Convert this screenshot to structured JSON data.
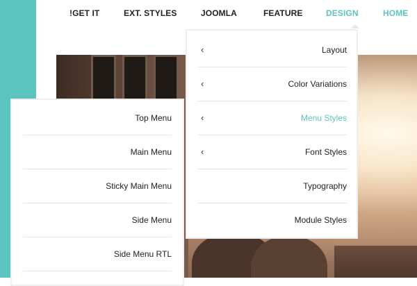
{
  "topnav": {
    "items": [
      {
        "label": "!GET IT",
        "active": false
      },
      {
        "label": "EXT. STYLES",
        "active": false
      },
      {
        "label": "JOOMLA",
        "active": false
      },
      {
        "label": "FEATURE",
        "active": false
      },
      {
        "label": "DESIGN",
        "active": true
      },
      {
        "label": "HOME",
        "active": true
      }
    ]
  },
  "design_menu": {
    "items": [
      {
        "label": "Layout",
        "has_submenu": true
      },
      {
        "label": "Color Variations",
        "has_submenu": true
      },
      {
        "label": "Menu Styles",
        "has_submenu": true,
        "active": true
      },
      {
        "label": "Font Styles",
        "has_submenu": true
      },
      {
        "label": "Typography",
        "has_submenu": false
      },
      {
        "label": "Module Styles",
        "has_submenu": false
      }
    ],
    "chevron_glyph": "‹"
  },
  "menu_styles_submenu": {
    "items": [
      {
        "label": "Top Menu"
      },
      {
        "label": "Main Menu"
      },
      {
        "label": "Sticky Main Menu"
      },
      {
        "label": "Side Menu"
      },
      {
        "label": "Side Menu RTL"
      }
    ]
  },
  "colors": {
    "accent": "#5bc4bf",
    "text": "#222222",
    "divider": "#e6e6e6"
  }
}
